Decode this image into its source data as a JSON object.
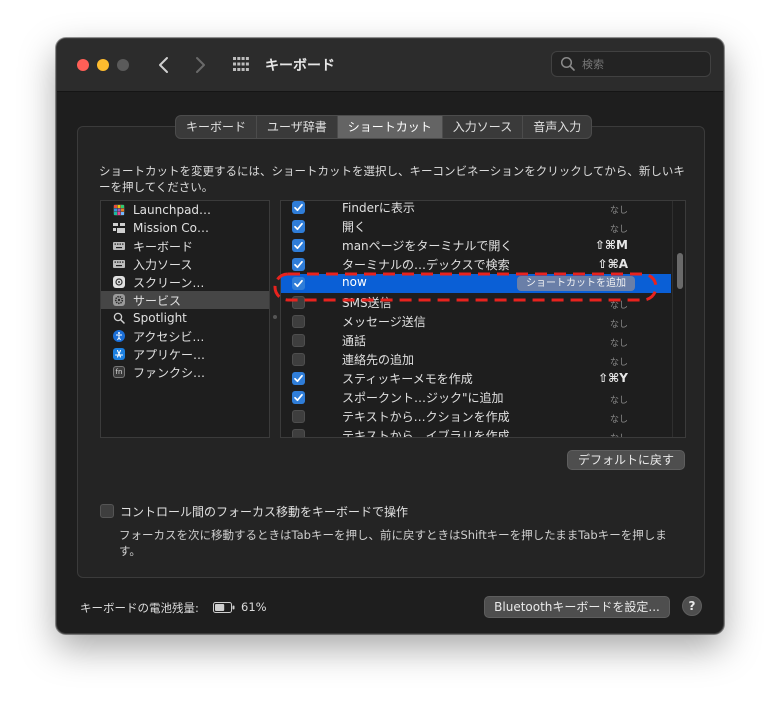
{
  "window": {
    "title": "キーボード"
  },
  "search": {
    "placeholder": "検索",
    "value": ""
  },
  "tabs": [
    {
      "label": "キーボード",
      "selected": false
    },
    {
      "label": "ユーザ辞書",
      "selected": false
    },
    {
      "label": "ショートカット",
      "selected": true
    },
    {
      "label": "入力ソース",
      "selected": false
    },
    {
      "label": "音声入力",
      "selected": false
    }
  ],
  "description": "ショートカットを変更するには、ショートカットを選択し、キーコンビネーションをクリックしてから、新しいキーを押してください。",
  "categories": [
    {
      "label": "Launchpad…",
      "icon": "launchpad-icon",
      "selected": false
    },
    {
      "label": "Mission Co…",
      "icon": "mission-control-icon",
      "selected": false
    },
    {
      "label": "キーボード",
      "icon": "keyboard-icon",
      "selected": false
    },
    {
      "label": "入力ソース",
      "icon": "input-sources-icon",
      "selected": false
    },
    {
      "label": "スクリーン…",
      "icon": "screenshot-icon",
      "selected": false
    },
    {
      "label": "サービス",
      "icon": "gear-icon",
      "selected": true
    },
    {
      "label": "Spotlight",
      "icon": "spotlight-icon",
      "selected": false
    },
    {
      "label": "アクセシビ…",
      "icon": "accessibility-icon",
      "selected": false
    },
    {
      "label": "アプリケー…",
      "icon": "app-store-icon",
      "selected": false
    },
    {
      "label": "ファンクシ…",
      "icon": "fn-icon",
      "selected": false
    }
  ],
  "shortcuts": [
    {
      "label": "Finderに表示",
      "checked": true,
      "shortcut": "なし",
      "selected": false
    },
    {
      "label": "開く",
      "checked": true,
      "shortcut": "なし",
      "selected": false
    },
    {
      "label": "manページをターミナルで開く",
      "checked": true,
      "shortcut": "⇧⌘M",
      "selected": false
    },
    {
      "label": "ターミナルの…デックスで検索",
      "checked": true,
      "shortcut": "⇧⌘A",
      "selected": false
    },
    {
      "label": "now",
      "checked": true,
      "shortcut": "",
      "selected": true,
      "action_label": "ショートカットを追加"
    },
    {
      "label": "SMS送信",
      "checked": false,
      "shortcut": "なし",
      "selected": false
    },
    {
      "label": "メッセージ送信",
      "checked": false,
      "shortcut": "なし",
      "selected": false
    },
    {
      "label": "通話",
      "checked": false,
      "shortcut": "なし",
      "selected": false
    },
    {
      "label": "連絡先の追加",
      "checked": false,
      "shortcut": "なし",
      "selected": false
    },
    {
      "label": "スティッキーメモを作成",
      "checked": true,
      "shortcut": "⇧⌘Y",
      "selected": false
    },
    {
      "label": "スポークント…ジック\"に追加",
      "checked": true,
      "shortcut": "なし",
      "selected": false
    },
    {
      "label": "テキストから…クションを作成",
      "checked": false,
      "shortcut": "なし",
      "selected": false
    },
    {
      "label": "テキストから…イブラリを作成",
      "checked": false,
      "shortcut": "なし",
      "selected": false
    }
  ],
  "buttons": {
    "restore_defaults": "デフォルトに戻す",
    "bluetooth_setup": "Bluetoothキーボードを設定...",
    "help": "?"
  },
  "keyboard_nav": {
    "label": "コントロール間のフォーカス移動をキーボードで操作",
    "checked": false,
    "description": "フォーカスを次に移動するときはTabキーを押し、前に戻すときはShiftキーを押したままTabキーを押します。"
  },
  "battery": {
    "label": "キーボードの電池残量:",
    "percent": "61%",
    "level": 0.61
  },
  "colors": {
    "accent": "#0a5fd6",
    "highlight_ring": "#e8231e",
    "checkbox_on": "#2f7dd8"
  }
}
